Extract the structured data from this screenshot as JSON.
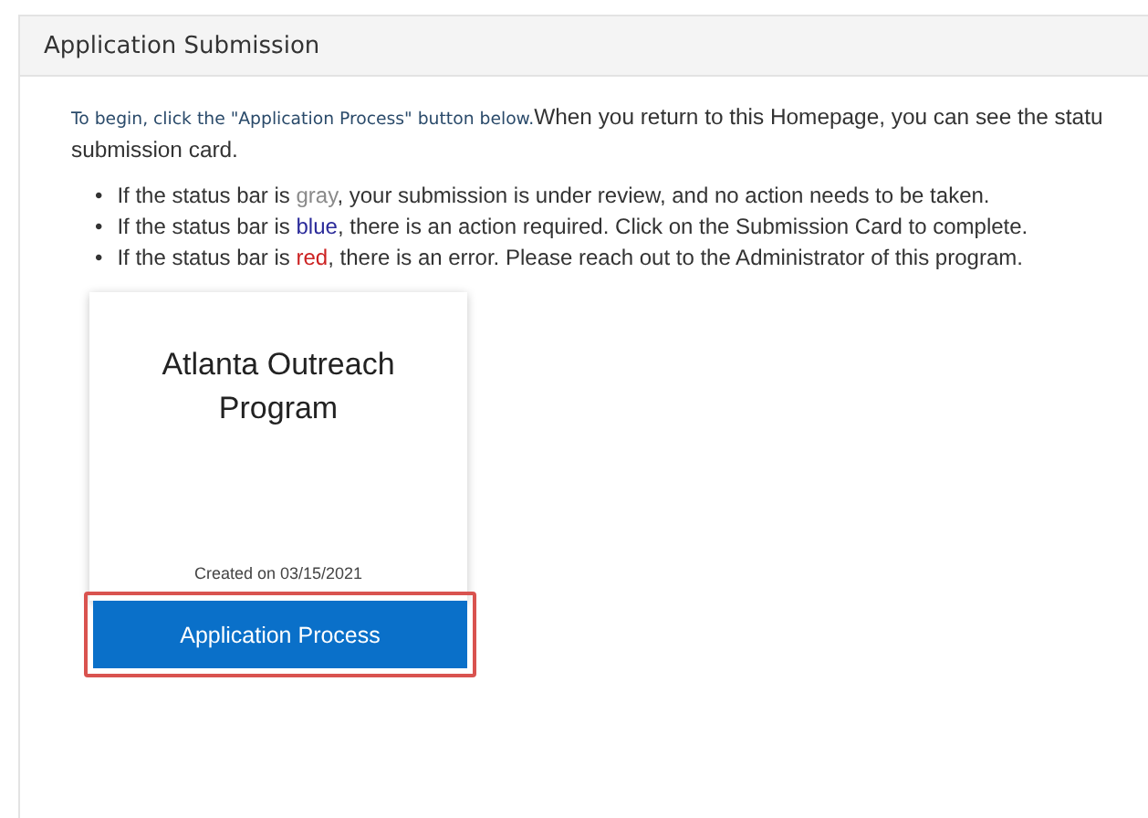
{
  "panel": {
    "title": "Application Submission"
  },
  "intro": {
    "lead": "To begin, click the \"Application Process\" button below.",
    "rest": "When you return to this Homepage, you can see the statu",
    "continued": "submission card."
  },
  "bullets": [
    {
      "marker": "•",
      "before": "If the status bar is ",
      "word": "gray",
      "color": "#8a8a8a",
      "after": ", your submission is under review, and no action needs to be taken."
    },
    {
      "marker": "•",
      "before": "If the status bar is ",
      "word": "blue",
      "color": "#2b2b9a",
      "after": ", there is an action required. Click on the Submission Card to complete."
    },
    {
      "marker": "•",
      "before": "If the status bar is ",
      "word": "red",
      "color": "#cc2222",
      "after": ", there is an error. Please reach out to the Administrator of this program."
    }
  ],
  "card": {
    "title": "Atlanta Outreach Program",
    "created": "Created on 03/15/2021",
    "button": "Application Process",
    "highlighted": true
  }
}
